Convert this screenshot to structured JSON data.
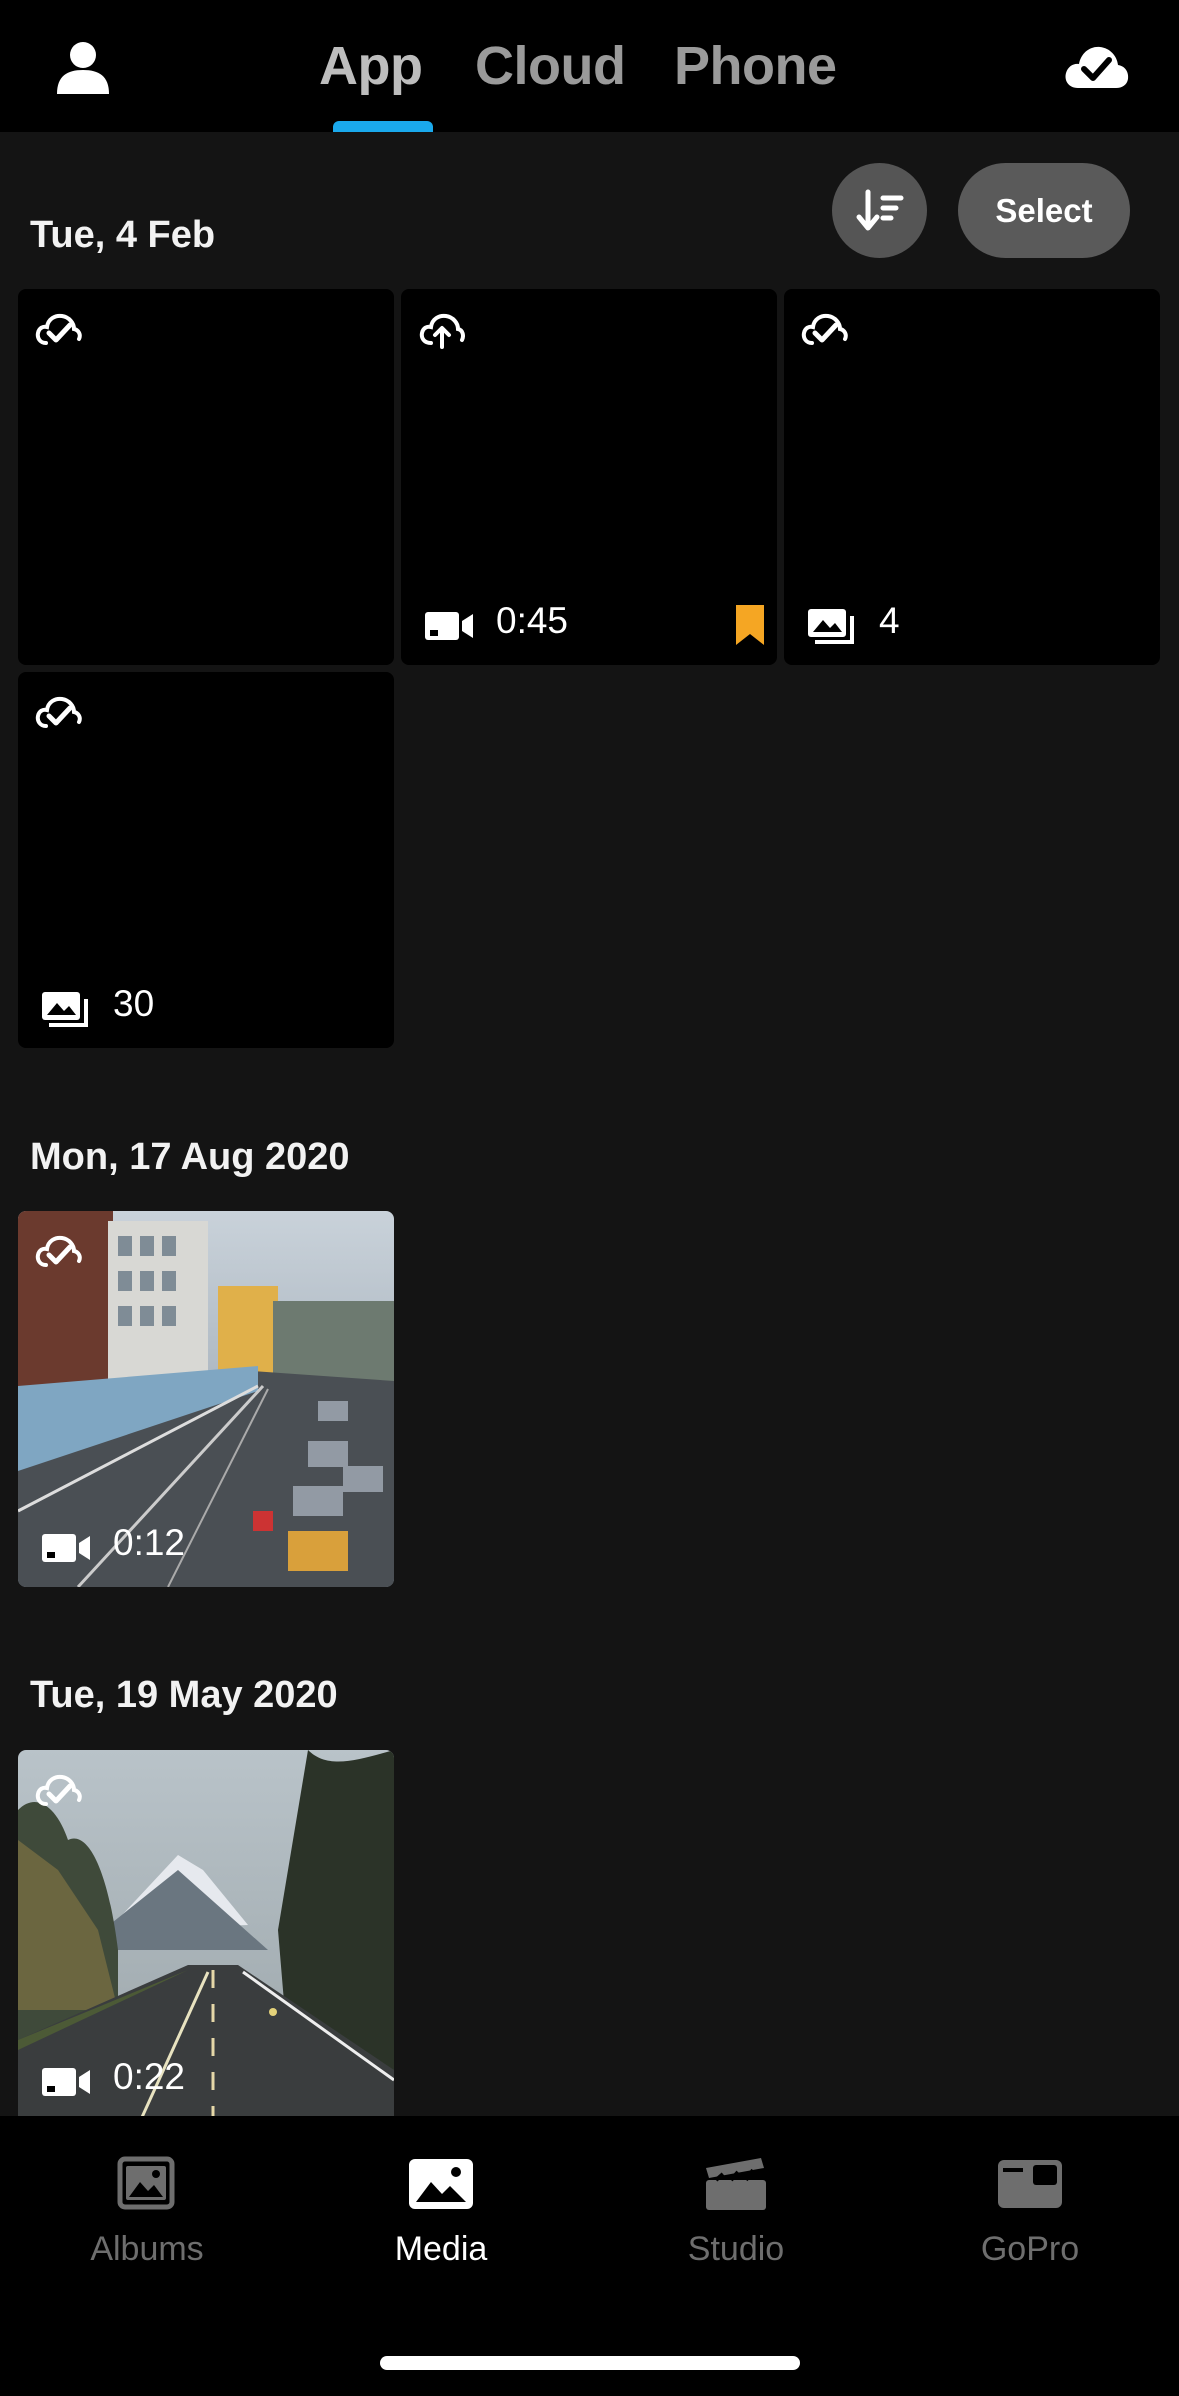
{
  "header": {
    "tabs": [
      {
        "label": "App",
        "active": true
      },
      {
        "label": "Cloud",
        "active": false
      },
      {
        "label": "Phone",
        "active": false
      }
    ],
    "profile_icon": "user-icon",
    "cloud_icon": "cloud-check-icon",
    "accent_color": "#1aa9ec"
  },
  "toolbar": {
    "sort_icon": "sort-icon",
    "select_label": "Select"
  },
  "sections": [
    {
      "date": "Tue, 4 Feb",
      "items": [
        {
          "status_icon": "cloud-synced-icon"
        },
        {
          "status_icon": "cloud-upload-icon",
          "type_icon": "video-icon",
          "meta": "0:45",
          "hilight_icon": "hilight-tag-icon",
          "hilight_color": "#f5a623"
        },
        {
          "status_icon": "cloud-synced-icon",
          "type_icon": "burst-photo-icon",
          "meta": "4"
        },
        {
          "status_icon": "cloud-synced-icon",
          "type_icon": "burst-photo-icon",
          "meta": "30"
        }
      ]
    },
    {
      "date": "Mon, 17 Aug 2020",
      "items": [
        {
          "status_icon": "cloud-synced-icon",
          "type_icon": "video-icon",
          "meta": "0:12",
          "thumbnail": "city-highway-traffic"
        }
      ]
    },
    {
      "date": "Tue, 19 May 2020",
      "items": [
        {
          "status_icon": "cloud-synced-icon",
          "type_icon": "video-icon",
          "meta": "0:22",
          "thumbnail": "mountain-road"
        }
      ]
    }
  ],
  "bottom_nav": [
    {
      "label": "Albums",
      "icon": "albums-icon",
      "active": false
    },
    {
      "label": "Media",
      "icon": "media-icon",
      "active": true
    },
    {
      "label": "Studio",
      "icon": "studio-clapper-icon",
      "active": false
    },
    {
      "label": "GoPro",
      "icon": "camera-icon",
      "active": false
    }
  ]
}
